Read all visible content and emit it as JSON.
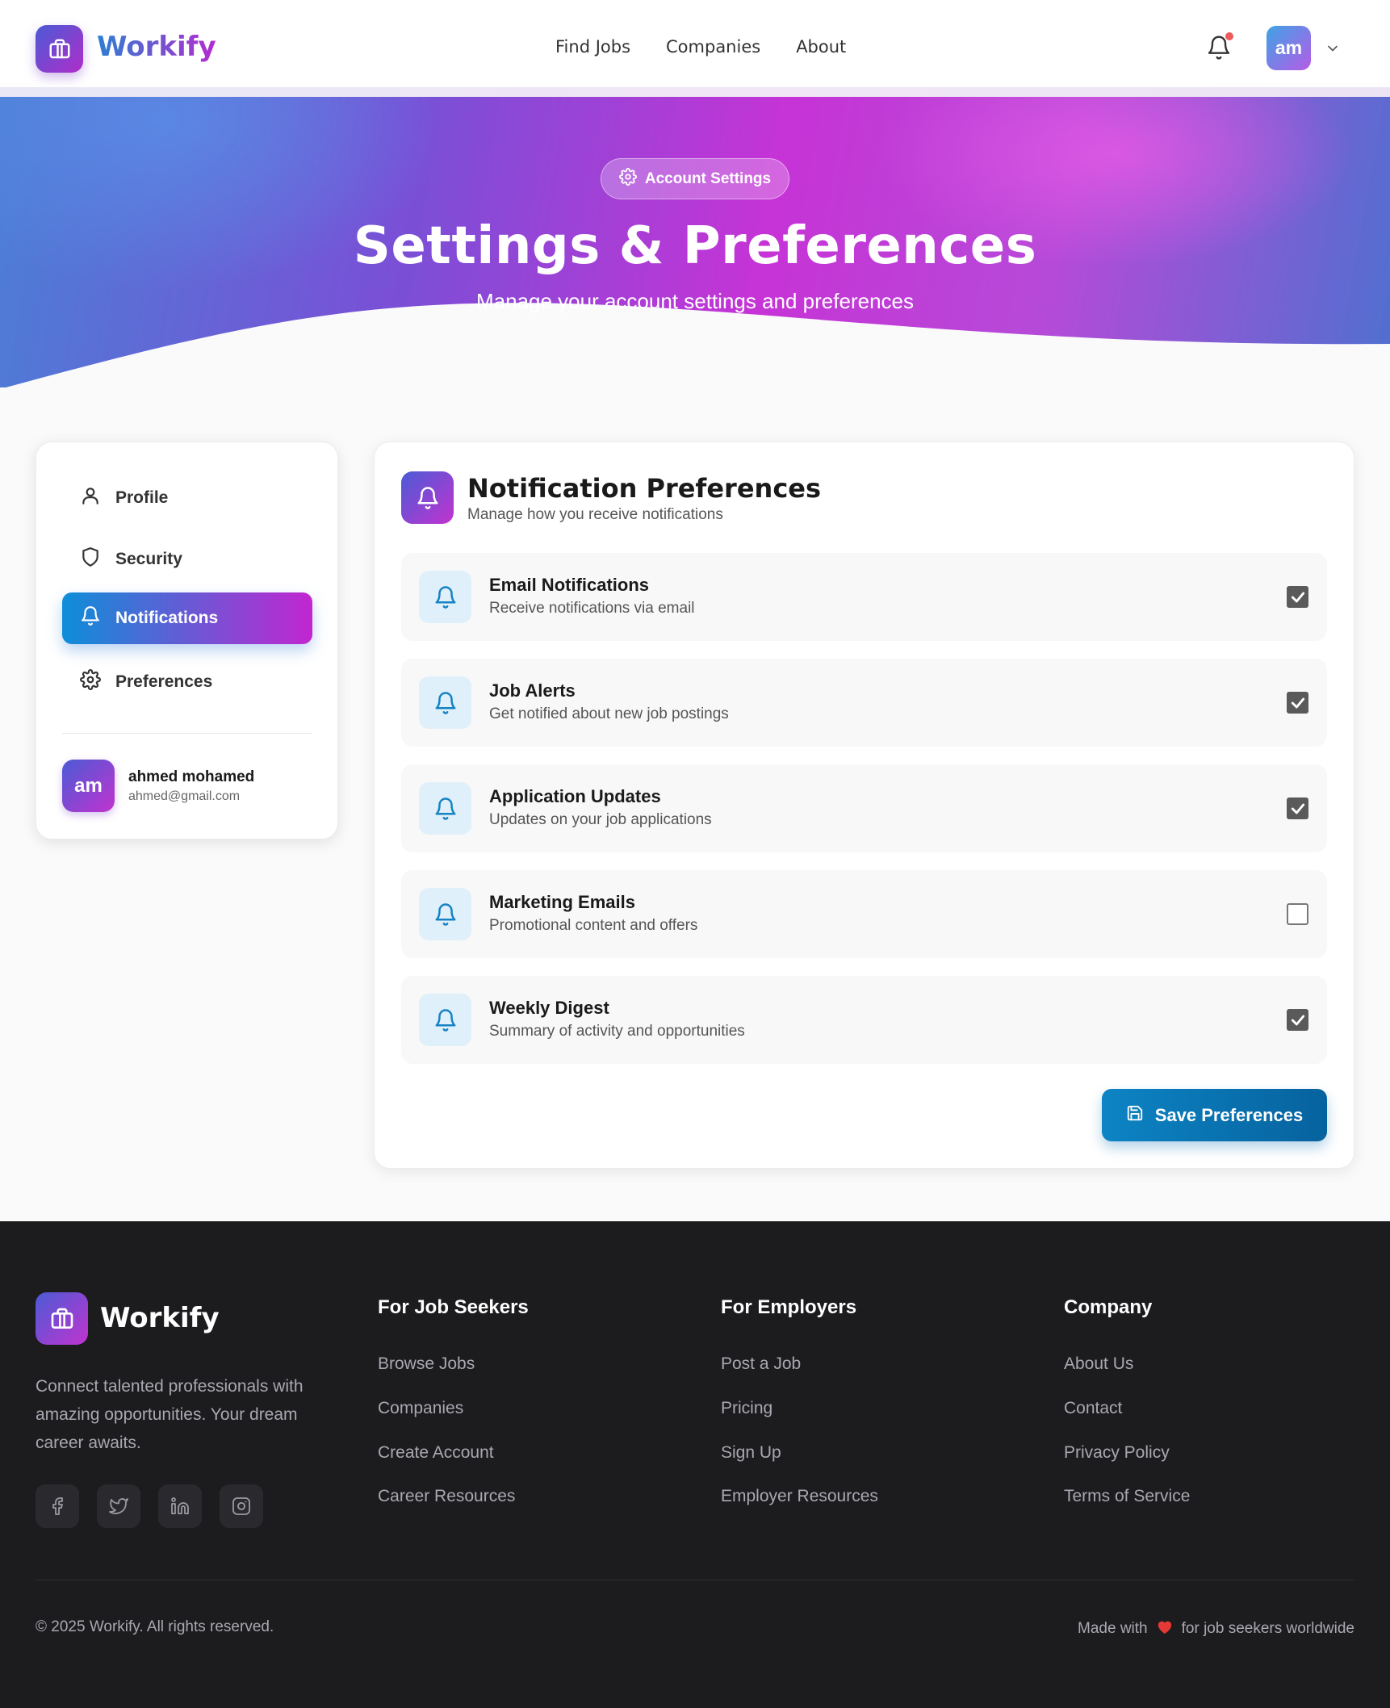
{
  "brand": {
    "name": "Workify"
  },
  "nav": {
    "links": [
      "Find Jobs",
      "Companies",
      "About"
    ],
    "avatar_initials": "am",
    "has_unread": true
  },
  "hero": {
    "pill_label": "Account Settings",
    "title": "Settings & Preferences",
    "subtitle": "Manage your account settings and preferences"
  },
  "sidebar": {
    "items": [
      {
        "label": "Profile",
        "icon": "user-icon",
        "active": false
      },
      {
        "label": "Security",
        "icon": "shield-icon",
        "active": false
      },
      {
        "label": "Notifications",
        "icon": "bell-icon",
        "active": true
      },
      {
        "label": "Preferences",
        "icon": "gear-icon",
        "active": false
      }
    ],
    "user": {
      "initials": "am",
      "name": "ahmed mohamed",
      "email": "ahmed@gmail.com"
    }
  },
  "notifications": {
    "title": "Notification Preferences",
    "subtitle": "Manage how you receive notifications",
    "items": [
      {
        "title": "Email Notifications",
        "desc": "Receive notifications via email",
        "checked": true
      },
      {
        "title": "Job Alerts",
        "desc": "Get notified about new job postings",
        "checked": true
      },
      {
        "title": "Application Updates",
        "desc": "Updates on your job applications",
        "checked": true
      },
      {
        "title": "Marketing Emails",
        "desc": "Promotional content and offers",
        "checked": false
      },
      {
        "title": "Weekly Digest",
        "desc": "Summary of activity and opportunities",
        "checked": true
      }
    ],
    "save_label": "Save Preferences"
  },
  "footer": {
    "brand": "Workify",
    "description": "Connect talented professionals with amazing opportunities. Your dream career awaits.",
    "social": [
      "facebook-icon",
      "twitter-icon",
      "linkedin-icon",
      "instagram-icon"
    ],
    "columns": [
      {
        "title": "For Job Seekers",
        "links": [
          "Browse Jobs",
          "Companies",
          "Create Account",
          "Career Resources"
        ]
      },
      {
        "title": "For Employers",
        "links": [
          "Post a Job",
          "Pricing",
          "Sign Up",
          "Employer Resources"
        ]
      },
      {
        "title": "Company",
        "links": [
          "About Us",
          "Contact",
          "Privacy Policy",
          "Terms of Service"
        ]
      }
    ],
    "copyright": "© 2025 Workify. All rights reserved.",
    "made_with_prefix": "Made with",
    "made_with_suffix": "for job seekers worldwide"
  },
  "colors": {
    "primary_blue": "#0d84c4",
    "accent_magenta": "#c226d0",
    "footer_bg": "#1c1c1f"
  }
}
